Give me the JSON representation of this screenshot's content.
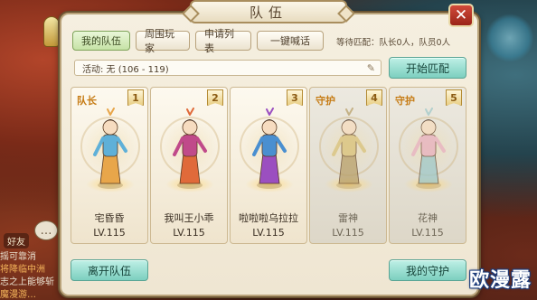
{
  "window": {
    "title": "队伍",
    "close_label": "✕"
  },
  "tabs": [
    {
      "label": "我的队伍",
      "active": true
    },
    {
      "label": "周围玩家",
      "active": false
    },
    {
      "label": "申请列表",
      "active": false
    },
    {
      "label": "一键喊话",
      "active": false
    }
  ],
  "wait_info": "等待匹配：队长0人，队员0人",
  "activity": {
    "text": "活动: 无 (106 - 119)",
    "edit_icon": "pencil-icon"
  },
  "buttons": {
    "start_match": "开始匹配",
    "leave_team": "离开队伍",
    "my_guard": "我的守护"
  },
  "members": [
    {
      "slot": "1",
      "role": "队长",
      "name": "宅昏昏",
      "level": "LV.115",
      "type": "player",
      "color": "#e8a64a",
      "accent": "#5fb0d8"
    },
    {
      "slot": "2",
      "role": "",
      "name": "我叫王小乖",
      "level": "LV.115",
      "type": "player",
      "color": "#e06a3a",
      "accent": "#c04a8a"
    },
    {
      "slot": "3",
      "role": "",
      "name": "啦啦啦乌拉拉",
      "level": "LV.115",
      "type": "player",
      "color": "#9b4fc0",
      "accent": "#4a8fd0"
    },
    {
      "slot": "4",
      "role": "守护",
      "name": "雷神",
      "level": "LV.115",
      "type": "guard",
      "color": "#b8a06a",
      "accent": "#d9c27a"
    },
    {
      "slot": "5",
      "role": "守护",
      "name": "花神",
      "level": "LV.115",
      "type": "guard",
      "color": "#9fc8c8",
      "accent": "#e8b0c0"
    }
  ],
  "chat": {
    "friend_label": "好友",
    "lines": [
      "摇可靠消",
      "将降临中洲",
      "志之上能够斩",
      "魔漫游…"
    ]
  },
  "watermark": "欧漫露",
  "colors": {
    "accent_green": "#7ccfbf",
    "leader_text": "#c67b14",
    "close_red": "#c23a2a"
  }
}
